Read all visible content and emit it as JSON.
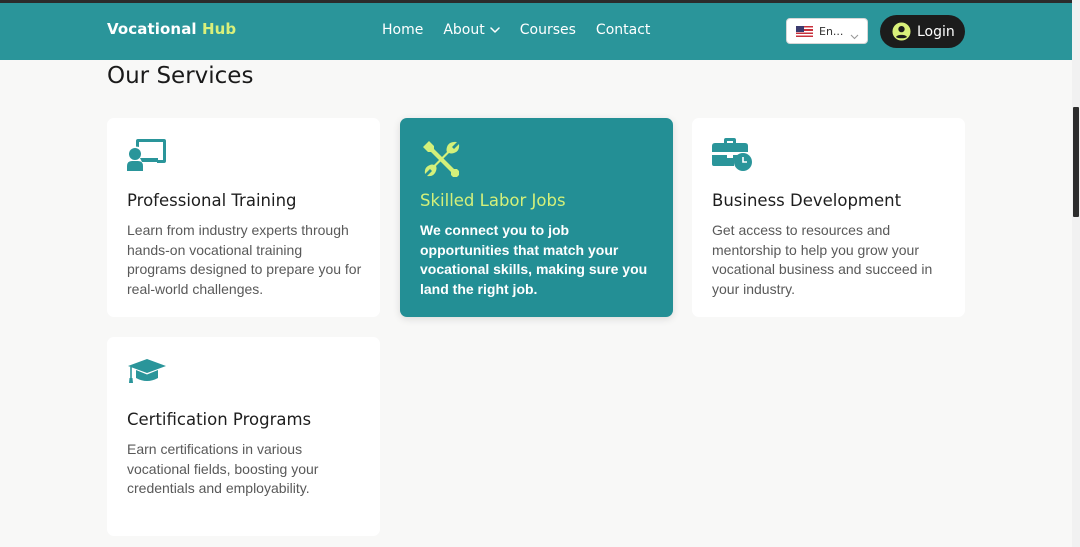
{
  "header": {
    "brand_main": "Vocational",
    "brand_accent": "Hub",
    "nav": [
      "Home",
      "About",
      "Courses",
      "Contact"
    ],
    "language": "En...",
    "login_label": "Login"
  },
  "services": {
    "title": "Our Services",
    "cards": [
      {
        "icon": "chalkboard-teacher-icon",
        "title": "Professional Training",
        "description": "Learn from industry experts through hands-on vocational training programs designed to prepare you for real-world challenges."
      },
      {
        "icon": "tools-icon",
        "title": "Skilled Labor Jobs",
        "description": "We connect you to job opportunities that match your vocational skills, making sure you land the right job."
      },
      {
        "icon": "business-time-icon",
        "title": "Business Development",
        "description": "Get access to resources and mentorship to help you grow your vocational business and succeed in your industry."
      },
      {
        "icon": "graduation-cap-icon",
        "title": "Certification Programs",
        "description": "Earn certifications in various vocational fields, boosting your credentials and employability."
      }
    ]
  },
  "colors": {
    "primary": "#2a959a",
    "accent": "#d9f07a",
    "dark": "#1c1c1c"
  }
}
